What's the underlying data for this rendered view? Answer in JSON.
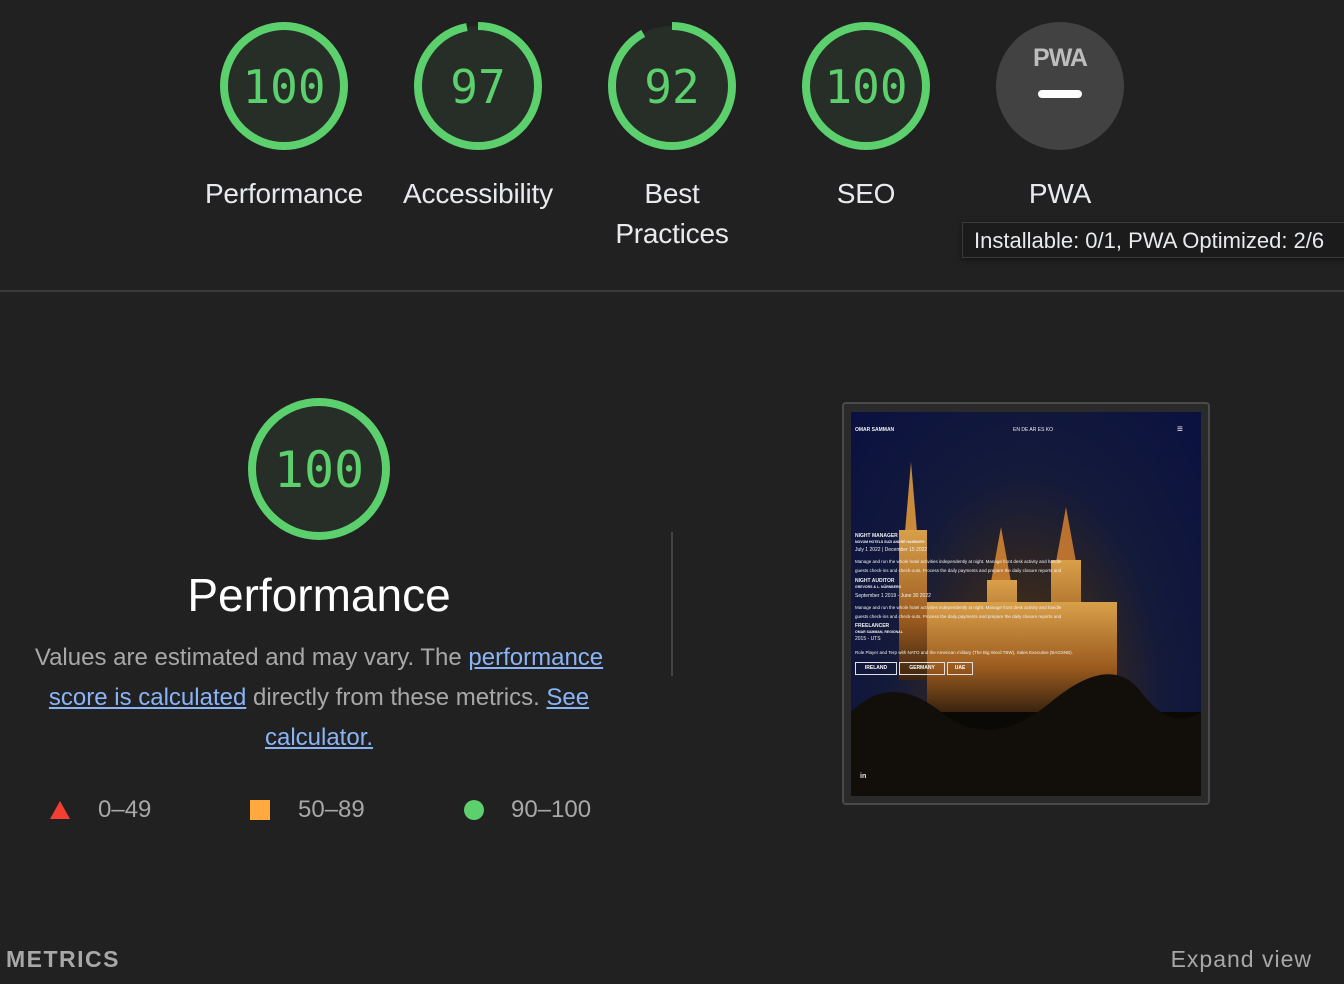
{
  "categories": [
    {
      "id": "performance",
      "score": "100",
      "label": "Performance",
      "fraction": 1.0
    },
    {
      "id": "accessibility",
      "score": "97",
      "label": "Accessibility",
      "fraction": 0.97
    },
    {
      "id": "best-practices",
      "score": "92",
      "label": "Best Practices",
      "fraction": 0.92
    },
    {
      "id": "seo",
      "score": "100",
      "label": "SEO",
      "fraction": 1.0
    },
    {
      "id": "pwa",
      "badge": "PWA",
      "label": "PWA"
    }
  ],
  "tooltip": "Installable: 0/1, PWA Optimized: 2/6",
  "performance": {
    "score": "100",
    "title": "Performance",
    "desc_pre": "Values are estimated and may vary. The ",
    "link1": "performance score is calculated",
    "desc_mid": " directly from these metrics. ",
    "link2": "See calculator.",
    "legend": {
      "fail": "0–49",
      "average": "50–89",
      "pass": "90–100"
    }
  },
  "colors": {
    "pass": "#5bd06d",
    "average": "#ffa93e",
    "fail": "#f33f33",
    "bg": "#212121"
  },
  "screenshot": {
    "name": "OMAR SAMMAN",
    "langs": "EN DE AR ES KO",
    "job1_title": "NIGHT MANAGER",
    "job1_company": "NOVUM HOTELS SUZI ANDRÉ HAMBURG",
    "job1_dates": "July 1 2022 | December 15 2022",
    "job1_line1": "Manage and run the whole hotel activities independently at night. Manage front desk activity and handle",
    "job1_line2": "guests check-ins and check-outs. Process the daily payments and prepare the daily closure reports and",
    "job2_title": "NIGHT AUDITOR",
    "job2_company": "GREVORS & L. NÜRNBERG",
    "job2_dates": "September 1 2019 - June 30 2022",
    "job2_line1": "Manage and run the whole hotel activities independently at night. Manage front desk activity and handle",
    "job2_line2": "guests check-ins and check-outs. Process the daily payments and prepare the daily closure reports and",
    "job3_title": "FREELANCER",
    "job3_company": "OMAR SAMMAN, REGIONAL",
    "job3_dates": "2015 - UTS",
    "job3_line1": "Role Player and Terp with NATO and the American military (The Big Word TBW), Sales Executive (BAGSNB).",
    "tags": [
      "IRELAND",
      "GERMANY",
      "UAE"
    ],
    "social": "in"
  },
  "footer": {
    "metrics": "METRICS",
    "expand": "Expand view"
  }
}
